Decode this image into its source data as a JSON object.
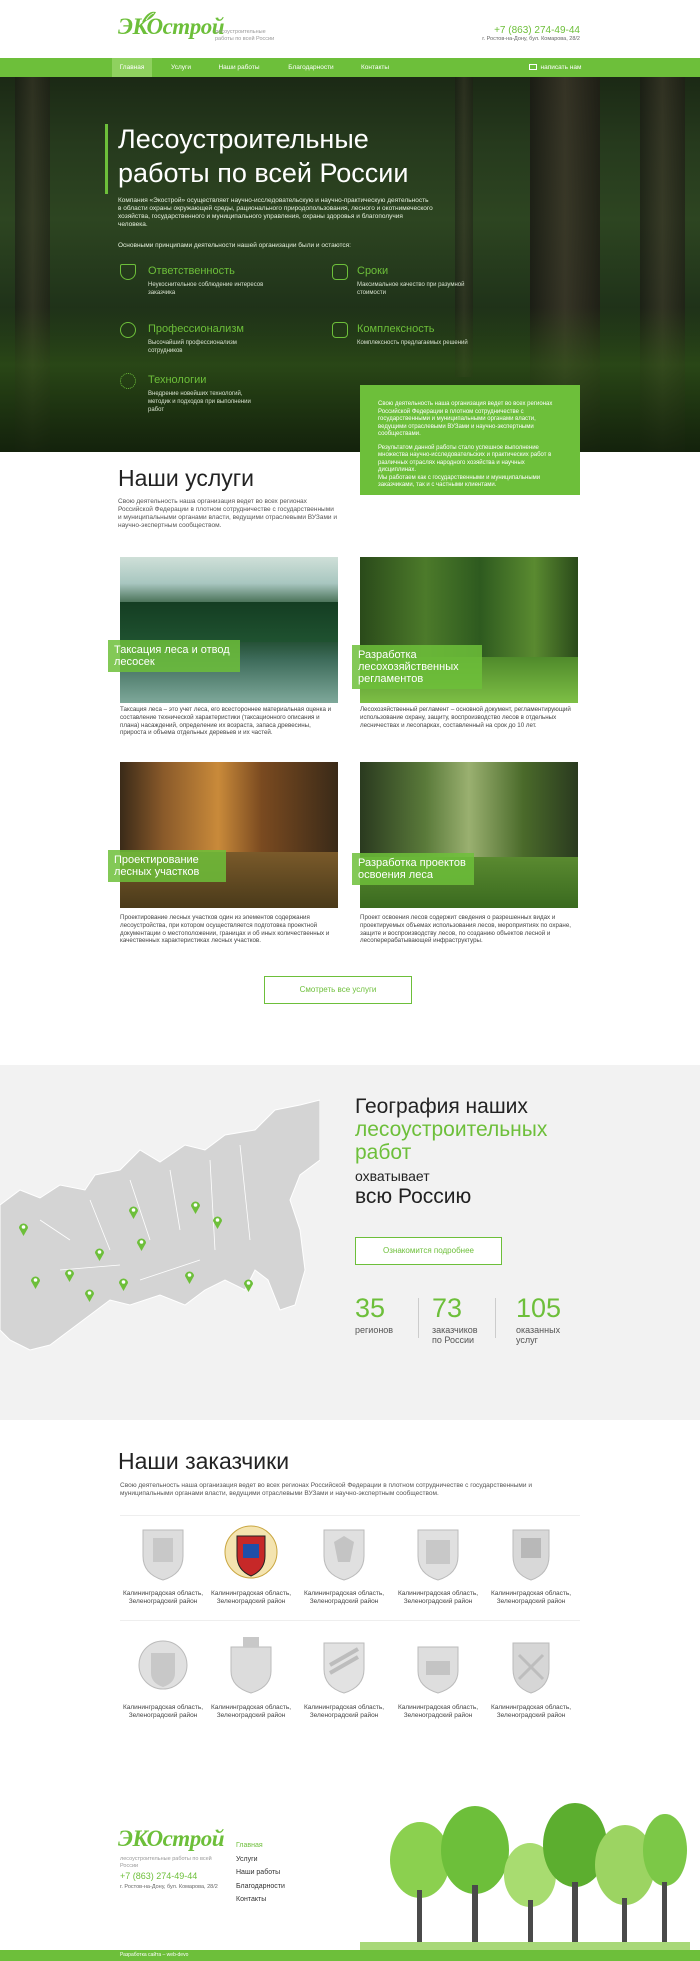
{
  "header": {
    "logo": "ЭКОстрой",
    "tagline": "лесоустроительные работы по всей России",
    "phone": "+7 (863) 274-49-44",
    "address": "г. Ростов-на-Дону, бул. Комарова, 28/2"
  },
  "nav": {
    "items": [
      "Главная",
      "Услуги",
      "Наши работы",
      "Благодарности",
      "Контакты"
    ],
    "write_us": "написать нам"
  },
  "hero": {
    "title": "Лесоустроительные работы по всей России",
    "intro": "Компания «Экострой» осуществляет научно-исследовательскую и научно-практическую деятельность в области охраны окружающей среды, рационального природопользования, лесного и окотнимеческого хозяйства, государственного и муниципального управления, охраны здоровья и благополучия человека.",
    "principles": "Основными принципами деятельности нашей организации были и остаются:",
    "features": [
      {
        "title": "Ответственность",
        "text": "Неукоснительное соблюдение интересов заказчика",
        "icon": "shield-icon"
      },
      {
        "title": "Сроки",
        "text": "Максимальное качество при разумной стоимости",
        "icon": "calendar-icon"
      },
      {
        "title": "Профессионализм",
        "text": "Высочайший профессионализм сотрудников",
        "icon": "person-icon"
      },
      {
        "title": "Комплексность",
        "text": "Комплексность предлагаемых решений",
        "icon": "puzzle-icon"
      },
      {
        "title": "Технологии",
        "text": "Внедрение новейших технологий, методик и подходов при выполнении работ",
        "icon": "gear-icon"
      }
    ],
    "box_p1": "Свою деятельность наша организация ведет во всех регионах Российской Федерации в плотном сотрудничестве с государственными и муниципальными органами власти, ведущими отраслевыми ВУЗами и научно-экспертными сообществами.",
    "box_p2": "Результатом данной работы стало успешное выполнение множества научно-исследовательских и практических работ в различных отраслях народного хозяйства и научных дисциплинах.",
    "box_p3": "Мы работаем как с государственными и муниципальными заказчиками, так и с частными клиентами."
  },
  "services": {
    "title": "Наши услуги",
    "intro": "Свою деятельность наша организация ведет во всех регионах Российской Федерации в плотном сотрудничестве с государственными и муниципальными органами власти, ведущими отраслевыми ВУЗами и научно-экспертным сообществом.",
    "items": [
      {
        "label": "Таксация леса и отвод лесосек",
        "text": "Таксация леса – это учет леса, его всестороннее материальная оценка и составление технической характеристики (таксационного описания и плана) насаждений, определение их возраста, запаса древесины, прироста и объема отдельных деревьев и их частей."
      },
      {
        "label": "Разработка лесохозяйственных регламентов",
        "text": "Лесохозяйственный регламент – основной документ, регламентирующий использование охрану, защиту, воспроизводство лесов в отдельных лесничествах и лесопарках, составленный на срок до 10 лет."
      },
      {
        "label": "Проектирование лесных участков",
        "text": "Проектирование лесных участков один из элементов содержания лесоустройства, при котором осуществляется подготовка проектной документации о местоположении, границах и об иных количественных и качественных характеристиках лесных участков."
      },
      {
        "label": "Разработка проектов освоения леса",
        "text": "Проект освоения лесов содержит сведения о разрешенных видах и проектируемых объемах использования лесов, мероприятиях по охране, защите и воспроизводству лесов, по созданию объектов лесной и лесоперерабатывающей инфраструктуры."
      }
    ],
    "all_button": "Смотреть все услуги"
  },
  "geo": {
    "title_a": "География наших",
    "title_b": "лесоустроительных работ",
    "title_c": "охватывает",
    "title_d": "всю Россию",
    "button": "Ознакомится подробнее",
    "stats": [
      {
        "num": "35",
        "label": "регионов"
      },
      {
        "num": "73",
        "label": "заказчиков по России"
      },
      {
        "num": "105",
        "label": "оказанных услуг"
      }
    ]
  },
  "customers": {
    "title": "Наши заказчики",
    "intro": "Свою деятельность наша организация ведет во всех регионах Российской Федерации в плотном сотрудничестве с государственными и муниципальными органами власти, ведущими отраслевыми ВУЗами и научно-экспертным сообществом.",
    "items": [
      "Калининградская область, Зеленоградский район",
      "Калининградская область, Зеленоградский район",
      "Калининградская область, Зеленоградский район",
      "Калининградская область, Зеленоградский район",
      "Калининградская область, Зеленоградский район",
      "Калининградская область, Зеленоградский район",
      "Калининградская область, Зеленоградский район",
      "Калининградская область, Зеленоградский район",
      "Калининградская область, Зеленоградский район",
      "Калининградская область, Зеленоградский район"
    ]
  },
  "footer": {
    "logo": "ЭКОстрой",
    "tagline": "лесоустроительные работы по всей России",
    "phone": "+7 (863) 274-49-44",
    "address": "г. Ростов-на-Дону, бул. Комарова, 28/2",
    "links": [
      "Главная",
      "Услуги",
      "Наши работы",
      "Благодарности",
      "Контакты"
    ],
    "credit": "Разработка сайта – web-devo"
  }
}
